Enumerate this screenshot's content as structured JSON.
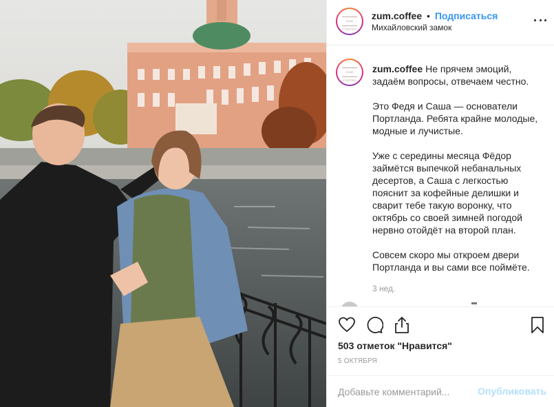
{
  "post": {
    "username": "zum.coffee",
    "separator": "•",
    "follow_label": "Подписаться",
    "location": "Михайловский замок",
    "avatar_text": "ZUM COFFEE",
    "caption": {
      "intro": "Не прячем эмоций, задаём вопросы, отвечаем честно.",
      "p2": "Это Федя и Саша — основатели Портланда. Ребята крайне молодые, модные и лучистые.",
      "p3": "Уже с середины месяца Фёдор займётся выпечкой небанальных десертов, а Саша с легкостью пояснит за кофейные делишки и сварит тебе такую воронку, что октябрь со своей зимней погодой нервно отойдёт на второй план.",
      "p4": "Совсем скоро мы откроем двери Портланда и вы сами все поймёте."
    },
    "time_ago": "3 нед.",
    "likes": "503 отметок \"Нравится\"",
    "date": "5 октября",
    "comment_placeholder": "Добавьте комментарий...",
    "publish_label": "Опубликовать"
  },
  "icons": {
    "like": "heart-icon",
    "comment": "comment-bubble-icon",
    "share": "share-icon",
    "save": "bookmark-icon",
    "more": "more-dots-icon"
  },
  "colors": {
    "accent": "#3897f0",
    "publish_disabled": "#b2dffc",
    "text": "#262626",
    "muted": "#999999",
    "divider": "#efefef"
  }
}
